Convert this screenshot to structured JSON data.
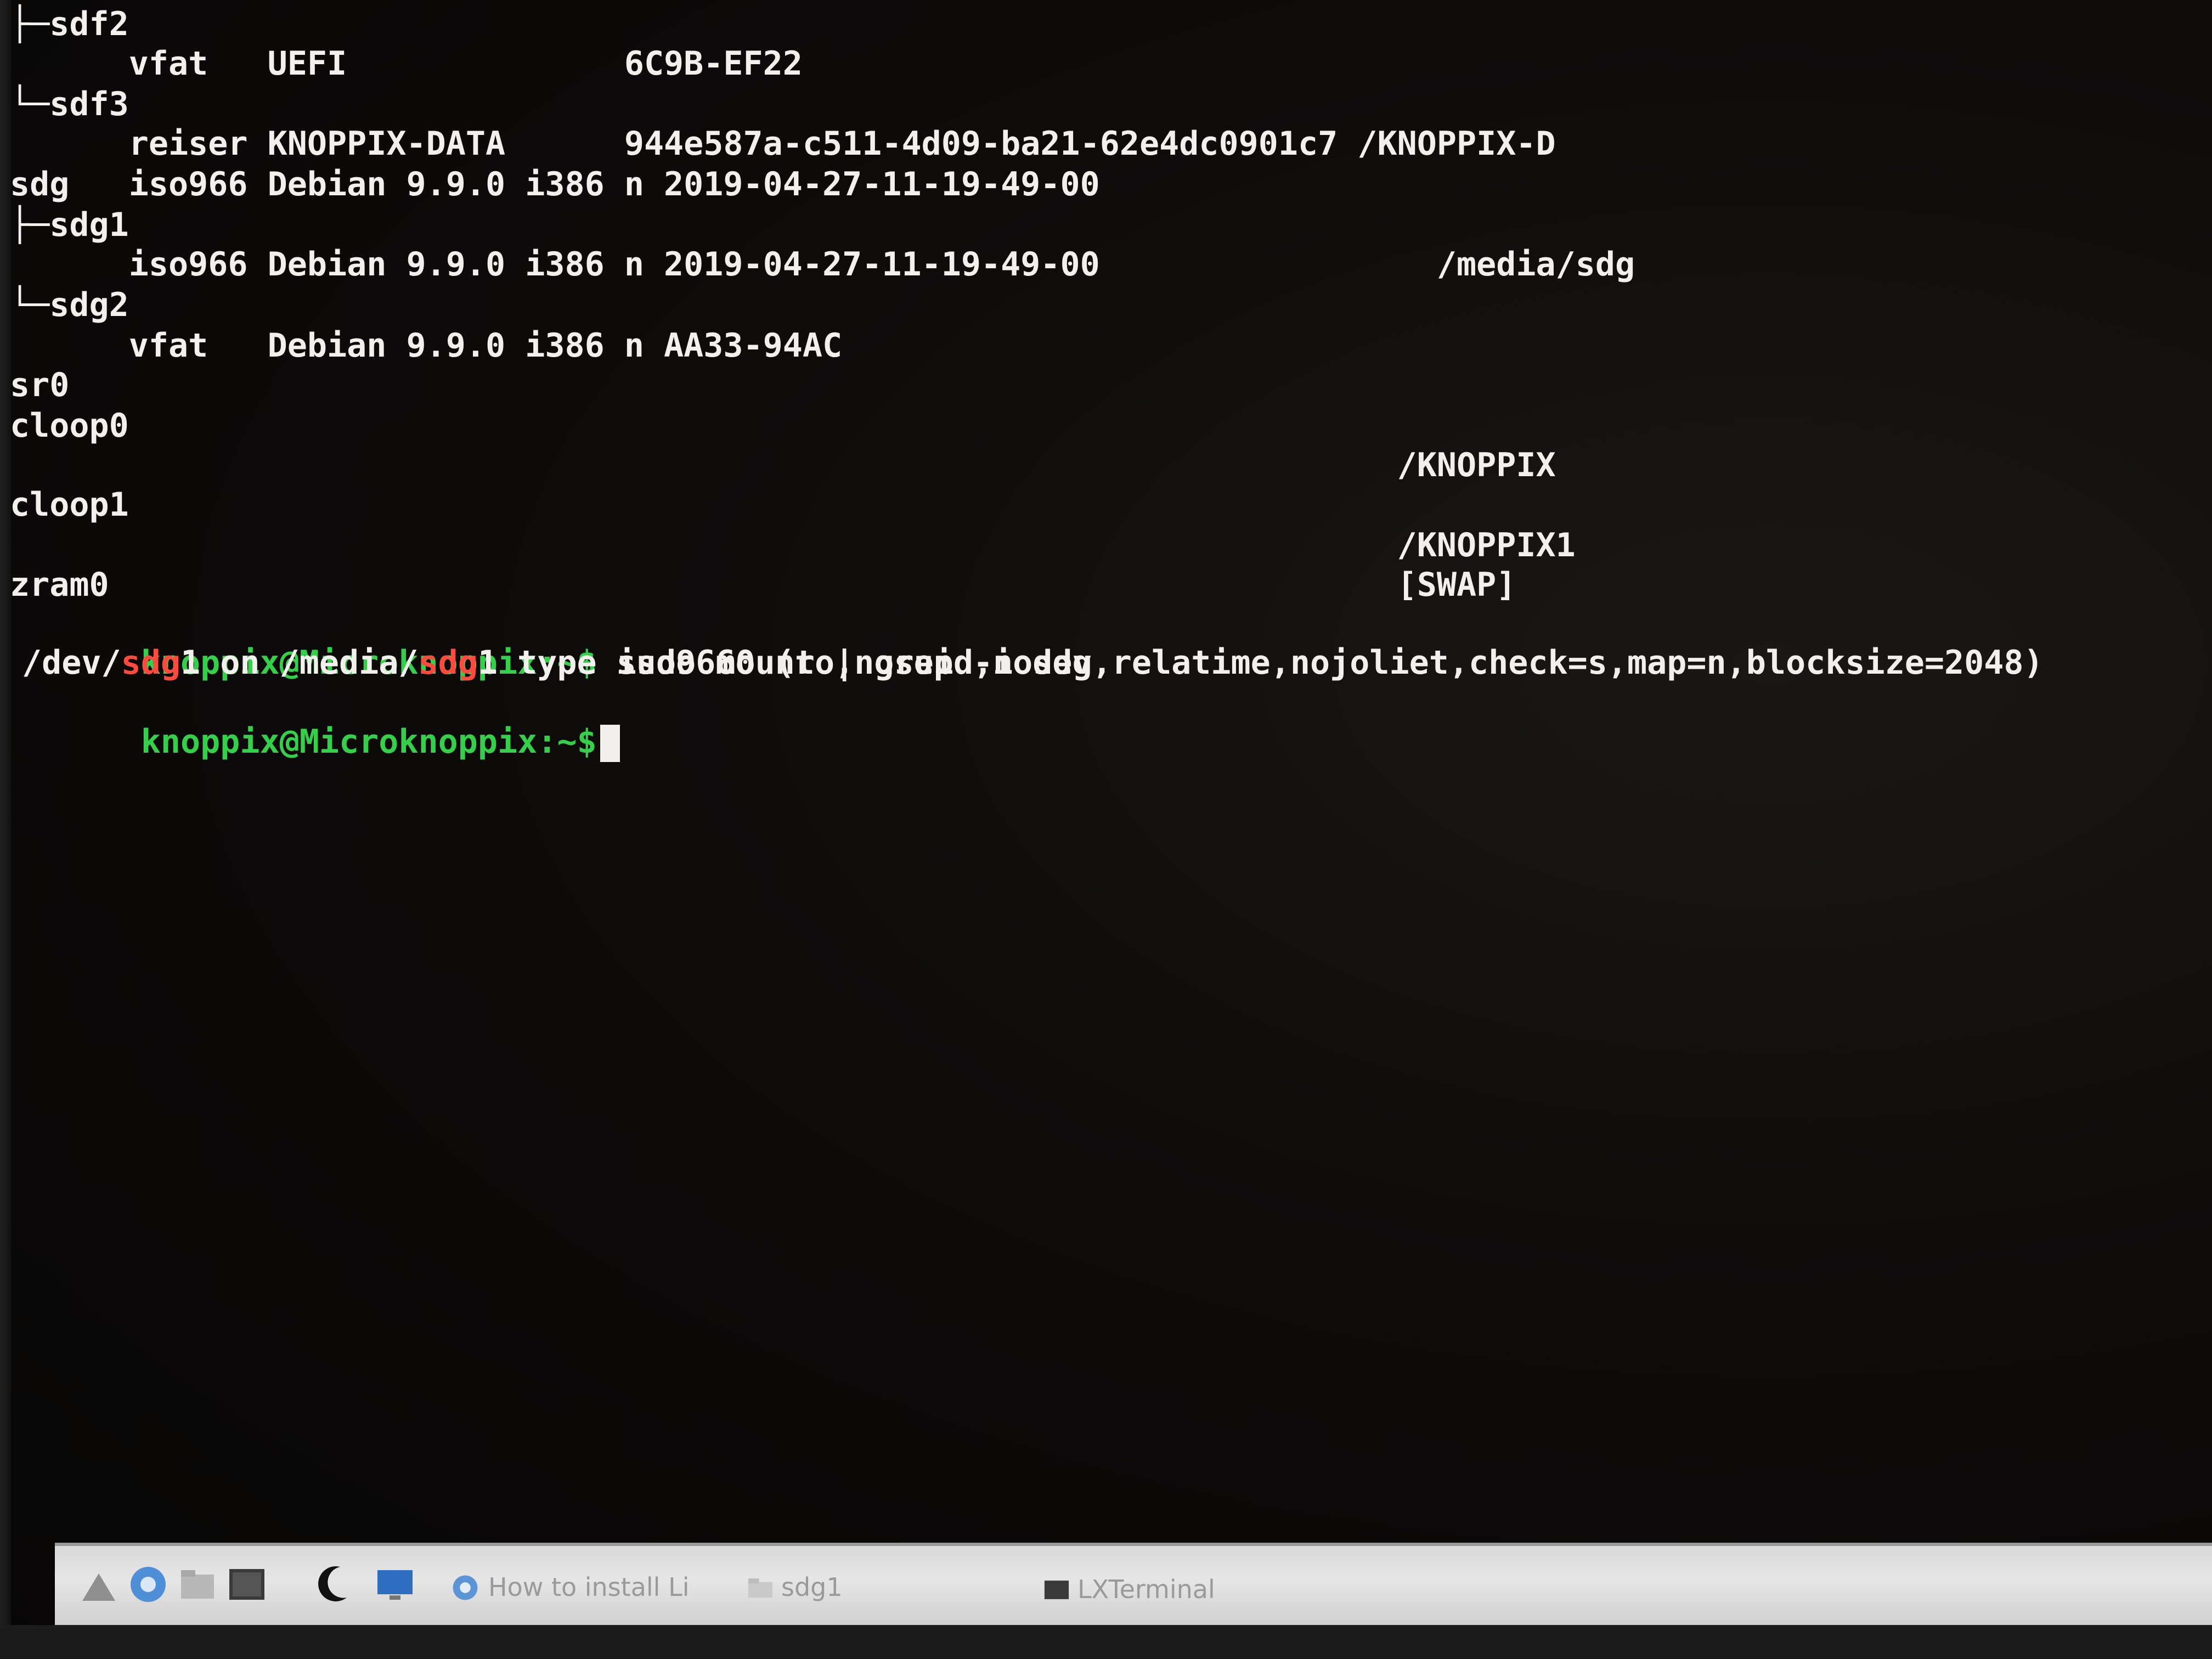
{
  "terminal": {
    "lines": [
      "├─sdf2",
      "      vfat   UEFI              6C9B-EF22",
      "└─sdf3",
      "      reiser KNOPPIX-DATA      944e587a-c511-4d09-ba21-62e4dc0901c7 /KNOPPIX-D",
      "sdg   iso966 Debian 9.9.0 i386 n 2019-04-27-11-19-49-00",
      "├─sdg1",
      "      iso966 Debian 9.9.0 i386 n 2019-04-27-11-19-49-00                 /media/sdg",
      "└─sdg2",
      "      vfat   Debian 9.9.0 i386 n AA33-94AC",
      "sr0",
      "cloop0",
      "                                                                      /KNOPPIX",
      "cloop1",
      "                                                                      /KNOPPIX1",
      "zram0                                                                 [SWAP]"
    ],
    "prompt": "knoppix@Microknoppix:~$",
    "command": " sudo mount | grep -i sdg",
    "mount_output": {
      "p1": "/dev/",
      "m1": "sdg",
      "p2": "1 on /media/",
      "m2": "sdg",
      "p3": "1 type iso9660 (ro,nosuid,nodev,relatime,nojoliet,check=s,map=n,blocksize=2048)"
    }
  },
  "taskbar": {
    "tasks": [
      {
        "label": "How to install Li"
      },
      {
        "label": "sdg1"
      },
      {
        "label": "LXTerminal"
      }
    ]
  }
}
